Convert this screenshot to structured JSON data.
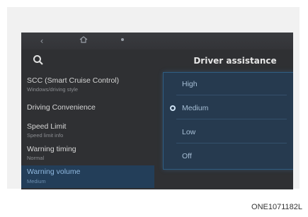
{
  "nav": {
    "back_icon": "chevron-left-icon",
    "home_icon": "home-icon",
    "menu_icon": "dots-icon"
  },
  "panel": {
    "title": "Driver assistance"
  },
  "menu": {
    "items": [
      {
        "label": "SCC (Smart Cruise Control)",
        "sub": "Windows/driving style"
      },
      {
        "label": "Driving Convenience",
        "sub": ""
      },
      {
        "label": "Speed Limit",
        "sub": "Speed limit info"
      },
      {
        "label": "Warning timing",
        "sub": "Normal"
      },
      {
        "label": "Warning volume",
        "sub": "Medium"
      }
    ]
  },
  "options": {
    "items": [
      {
        "label": "High",
        "selected": false
      },
      {
        "label": "Medium",
        "selected": true
      },
      {
        "label": "Low",
        "selected": false
      },
      {
        "label": "Off",
        "selected": false
      }
    ]
  },
  "footer": {
    "code": "ONE1071182L"
  },
  "colors": {
    "screen_bg": "#2f3033",
    "accent": "#2f5d82",
    "highlight": "#233e59"
  }
}
